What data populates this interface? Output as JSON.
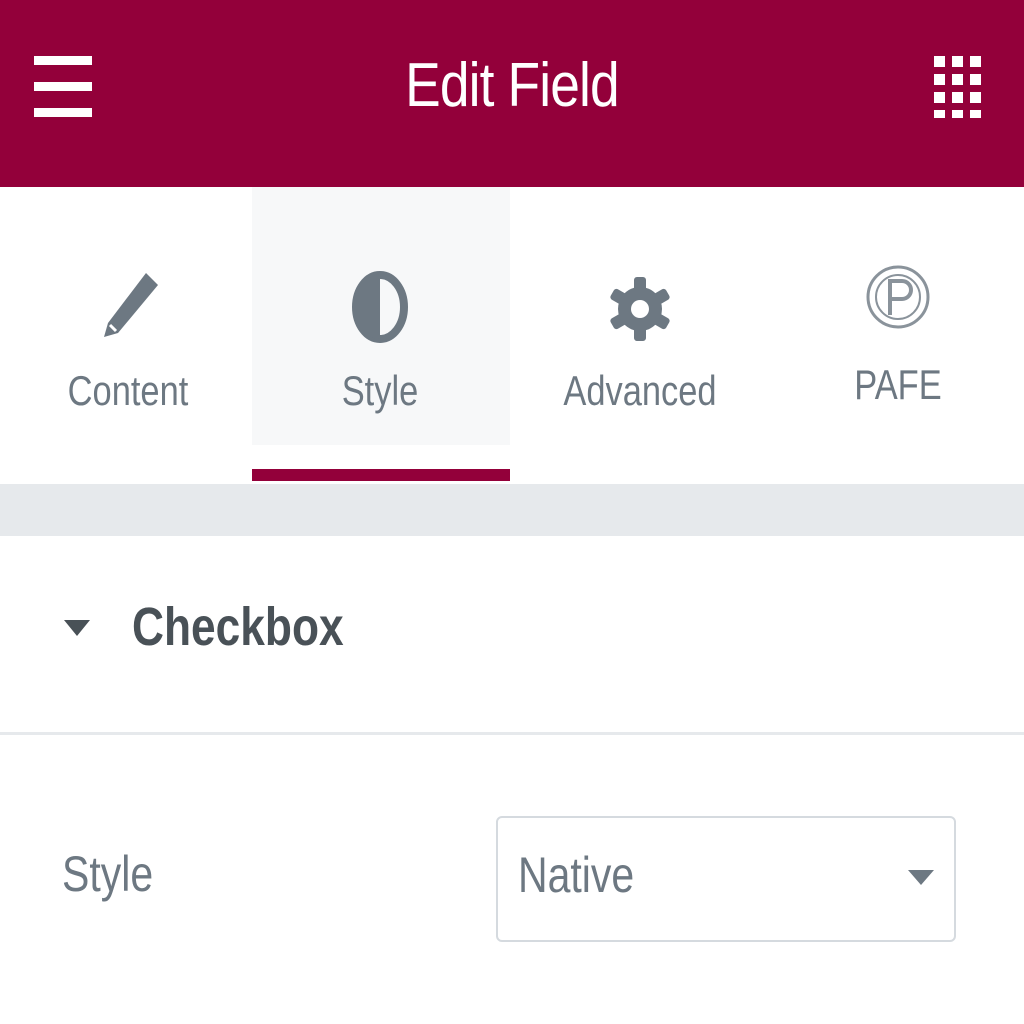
{
  "header": {
    "title": "Edit Field",
    "menu_icon": "hamburger-menu-icon",
    "apps_icon": "grid-apps-icon"
  },
  "tabs": [
    {
      "label": "Content",
      "icon": "pencil-icon"
    },
    {
      "label": "Style",
      "icon": "half-circle-icon",
      "active": true
    },
    {
      "label": "Advanced",
      "icon": "gear-icon"
    },
    {
      "label": "PAFE",
      "icon": "pafe-logo-icon"
    }
  ],
  "section": {
    "title": "Checkbox",
    "expanded": true
  },
  "control": {
    "label": "Style",
    "value": "Native",
    "options_visible": [
      "Native"
    ]
  },
  "colors": {
    "accent": "#93003a",
    "tab_active_bg": "#f7f8f9",
    "text_muted": "#6d7882",
    "text_dark": "#495157"
  }
}
